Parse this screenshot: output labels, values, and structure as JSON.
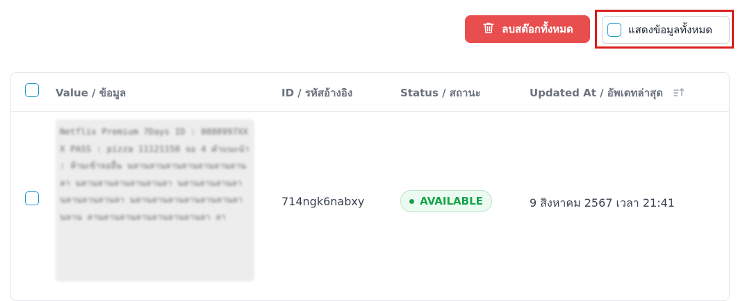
{
  "toolbar": {
    "delete_all_label": "ลบสต๊อกทั้งหมด",
    "show_all_label": "แสดงข้อมูลทั้งหมด",
    "delete_color": "#e94e4e",
    "highlight_color": "#d91c1c"
  },
  "table": {
    "columns": {
      "value": "Value / ข้อมูล",
      "id": "ID / รหัสอ้างอิง",
      "status": "Status / สถานะ",
      "updated": "Updated At / อัพเดทล่าสุด"
    },
    "rows": [
      {
        "value": "Netflix Premium 7Days ID : 0888997XXX PASS : pizza 11121150 จอ 4 คำแนะนำ : ห้ามเข้าจออื่น นลานลานลานลานลานลานลานลา นลานลานลานลานลานลา นลานลานลานลา นลานลานลานลา นลานลานลานลานลานลานลา นลาน ลานลานลานลานลานลานลานลา ลา",
        "id": "714ngk6nabxy",
        "status": "AVAILABLE",
        "status_color": "#16a34a",
        "updated_at": "9 สิงหาคม 2567 เวลา 21:41"
      }
    ]
  }
}
